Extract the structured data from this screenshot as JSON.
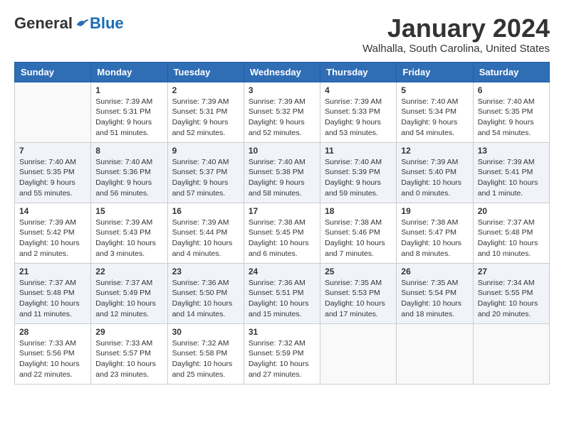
{
  "logo": {
    "general": "General",
    "blue": "Blue"
  },
  "header": {
    "title": "January 2024",
    "location": "Walhalla, South Carolina, United States"
  },
  "days_of_week": [
    "Sunday",
    "Monday",
    "Tuesday",
    "Wednesday",
    "Thursday",
    "Friday",
    "Saturday"
  ],
  "weeks": [
    [
      {
        "day": "",
        "sunrise": "",
        "sunset": "",
        "daylight": ""
      },
      {
        "day": "1",
        "sunrise": "Sunrise: 7:39 AM",
        "sunset": "Sunset: 5:31 PM",
        "daylight": "Daylight: 9 hours and 51 minutes."
      },
      {
        "day": "2",
        "sunrise": "Sunrise: 7:39 AM",
        "sunset": "Sunset: 5:31 PM",
        "daylight": "Daylight: 9 hours and 52 minutes."
      },
      {
        "day": "3",
        "sunrise": "Sunrise: 7:39 AM",
        "sunset": "Sunset: 5:32 PM",
        "daylight": "Daylight: 9 hours and 52 minutes."
      },
      {
        "day": "4",
        "sunrise": "Sunrise: 7:39 AM",
        "sunset": "Sunset: 5:33 PM",
        "daylight": "Daylight: 9 hours and 53 minutes."
      },
      {
        "day": "5",
        "sunrise": "Sunrise: 7:40 AM",
        "sunset": "Sunset: 5:34 PM",
        "daylight": "Daylight: 9 hours and 54 minutes."
      },
      {
        "day": "6",
        "sunrise": "Sunrise: 7:40 AM",
        "sunset": "Sunset: 5:35 PM",
        "daylight": "Daylight: 9 hours and 54 minutes."
      }
    ],
    [
      {
        "day": "7",
        "sunrise": "Sunrise: 7:40 AM",
        "sunset": "Sunset: 5:35 PM",
        "daylight": "Daylight: 9 hours and 55 minutes."
      },
      {
        "day": "8",
        "sunrise": "Sunrise: 7:40 AM",
        "sunset": "Sunset: 5:36 PM",
        "daylight": "Daylight: 9 hours and 56 minutes."
      },
      {
        "day": "9",
        "sunrise": "Sunrise: 7:40 AM",
        "sunset": "Sunset: 5:37 PM",
        "daylight": "Daylight: 9 hours and 57 minutes."
      },
      {
        "day": "10",
        "sunrise": "Sunrise: 7:40 AM",
        "sunset": "Sunset: 5:38 PM",
        "daylight": "Daylight: 9 hours and 58 minutes."
      },
      {
        "day": "11",
        "sunrise": "Sunrise: 7:40 AM",
        "sunset": "Sunset: 5:39 PM",
        "daylight": "Daylight: 9 hours and 59 minutes."
      },
      {
        "day": "12",
        "sunrise": "Sunrise: 7:39 AM",
        "sunset": "Sunset: 5:40 PM",
        "daylight": "Daylight: 10 hours and 0 minutes."
      },
      {
        "day": "13",
        "sunrise": "Sunrise: 7:39 AM",
        "sunset": "Sunset: 5:41 PM",
        "daylight": "Daylight: 10 hours and 1 minute."
      }
    ],
    [
      {
        "day": "14",
        "sunrise": "Sunrise: 7:39 AM",
        "sunset": "Sunset: 5:42 PM",
        "daylight": "Daylight: 10 hours and 2 minutes."
      },
      {
        "day": "15",
        "sunrise": "Sunrise: 7:39 AM",
        "sunset": "Sunset: 5:43 PM",
        "daylight": "Daylight: 10 hours and 3 minutes."
      },
      {
        "day": "16",
        "sunrise": "Sunrise: 7:39 AM",
        "sunset": "Sunset: 5:44 PM",
        "daylight": "Daylight: 10 hours and 4 minutes."
      },
      {
        "day": "17",
        "sunrise": "Sunrise: 7:38 AM",
        "sunset": "Sunset: 5:45 PM",
        "daylight": "Daylight: 10 hours and 6 minutes."
      },
      {
        "day": "18",
        "sunrise": "Sunrise: 7:38 AM",
        "sunset": "Sunset: 5:46 PM",
        "daylight": "Daylight: 10 hours and 7 minutes."
      },
      {
        "day": "19",
        "sunrise": "Sunrise: 7:38 AM",
        "sunset": "Sunset: 5:47 PM",
        "daylight": "Daylight: 10 hours and 8 minutes."
      },
      {
        "day": "20",
        "sunrise": "Sunrise: 7:37 AM",
        "sunset": "Sunset: 5:48 PM",
        "daylight": "Daylight: 10 hours and 10 minutes."
      }
    ],
    [
      {
        "day": "21",
        "sunrise": "Sunrise: 7:37 AM",
        "sunset": "Sunset: 5:48 PM",
        "daylight": "Daylight: 10 hours and 11 minutes."
      },
      {
        "day": "22",
        "sunrise": "Sunrise: 7:37 AM",
        "sunset": "Sunset: 5:49 PM",
        "daylight": "Daylight: 10 hours and 12 minutes."
      },
      {
        "day": "23",
        "sunrise": "Sunrise: 7:36 AM",
        "sunset": "Sunset: 5:50 PM",
        "daylight": "Daylight: 10 hours and 14 minutes."
      },
      {
        "day": "24",
        "sunrise": "Sunrise: 7:36 AM",
        "sunset": "Sunset: 5:51 PM",
        "daylight": "Daylight: 10 hours and 15 minutes."
      },
      {
        "day": "25",
        "sunrise": "Sunrise: 7:35 AM",
        "sunset": "Sunset: 5:53 PM",
        "daylight": "Daylight: 10 hours and 17 minutes."
      },
      {
        "day": "26",
        "sunrise": "Sunrise: 7:35 AM",
        "sunset": "Sunset: 5:54 PM",
        "daylight": "Daylight: 10 hours and 18 minutes."
      },
      {
        "day": "27",
        "sunrise": "Sunrise: 7:34 AM",
        "sunset": "Sunset: 5:55 PM",
        "daylight": "Daylight: 10 hours and 20 minutes."
      }
    ],
    [
      {
        "day": "28",
        "sunrise": "Sunrise: 7:33 AM",
        "sunset": "Sunset: 5:56 PM",
        "daylight": "Daylight: 10 hours and 22 minutes."
      },
      {
        "day": "29",
        "sunrise": "Sunrise: 7:33 AM",
        "sunset": "Sunset: 5:57 PM",
        "daylight": "Daylight: 10 hours and 23 minutes."
      },
      {
        "day": "30",
        "sunrise": "Sunrise: 7:32 AM",
        "sunset": "Sunset: 5:58 PM",
        "daylight": "Daylight: 10 hours and 25 minutes."
      },
      {
        "day": "31",
        "sunrise": "Sunrise: 7:32 AM",
        "sunset": "Sunset: 5:59 PM",
        "daylight": "Daylight: 10 hours and 27 minutes."
      },
      {
        "day": "",
        "sunrise": "",
        "sunset": "",
        "daylight": ""
      },
      {
        "day": "",
        "sunrise": "",
        "sunset": "",
        "daylight": ""
      },
      {
        "day": "",
        "sunrise": "",
        "sunset": "",
        "daylight": ""
      }
    ]
  ]
}
